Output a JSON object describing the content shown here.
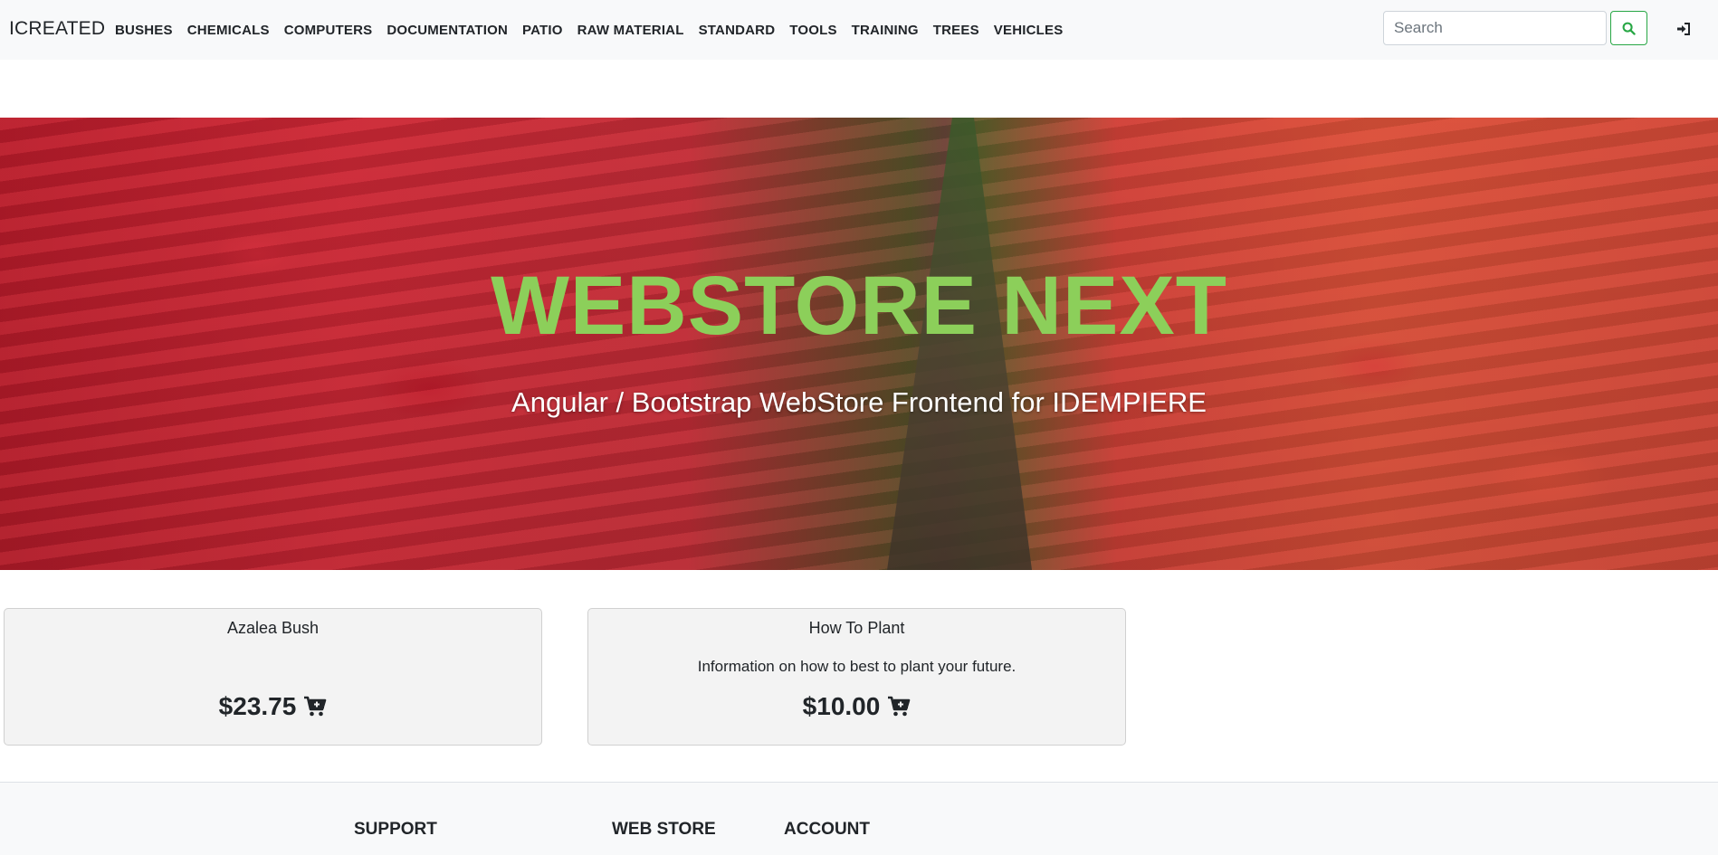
{
  "navbar": {
    "brand": "ICREATED",
    "items": [
      "BUSHES",
      "CHEMICALS",
      "COMPUTERS",
      "DOCUMENTATION",
      "PATIO",
      "RAW MATERIAL",
      "STANDARD",
      "TOOLS",
      "TRAINING",
      "TREES",
      "VEHICLES"
    ],
    "search_placeholder": "Search"
  },
  "icons": {
    "search": "search-icon",
    "login": "sign-in-icon",
    "cart": "cart-plus-icon"
  },
  "hero": {
    "title": "WEBSTORE NEXT",
    "subtitle": "Angular / Bootstrap WebStore Frontend for IDEMPIERE"
  },
  "products": [
    {
      "name": "Azalea Bush",
      "description": "",
      "price": "$23.75"
    },
    {
      "name": "How To Plant",
      "description": "Information on how to best to plant your future.",
      "price": "$10.00"
    }
  ],
  "footer": {
    "headings": [
      "SUPPORT",
      "WEB STORE",
      "ACCOUNT"
    ]
  },
  "colors": {
    "accent_green": "#28a745",
    "hero_title": "#8ccf5a",
    "navbar_bg": "#f8f9fa",
    "card_bg": "#f3f3f3"
  }
}
